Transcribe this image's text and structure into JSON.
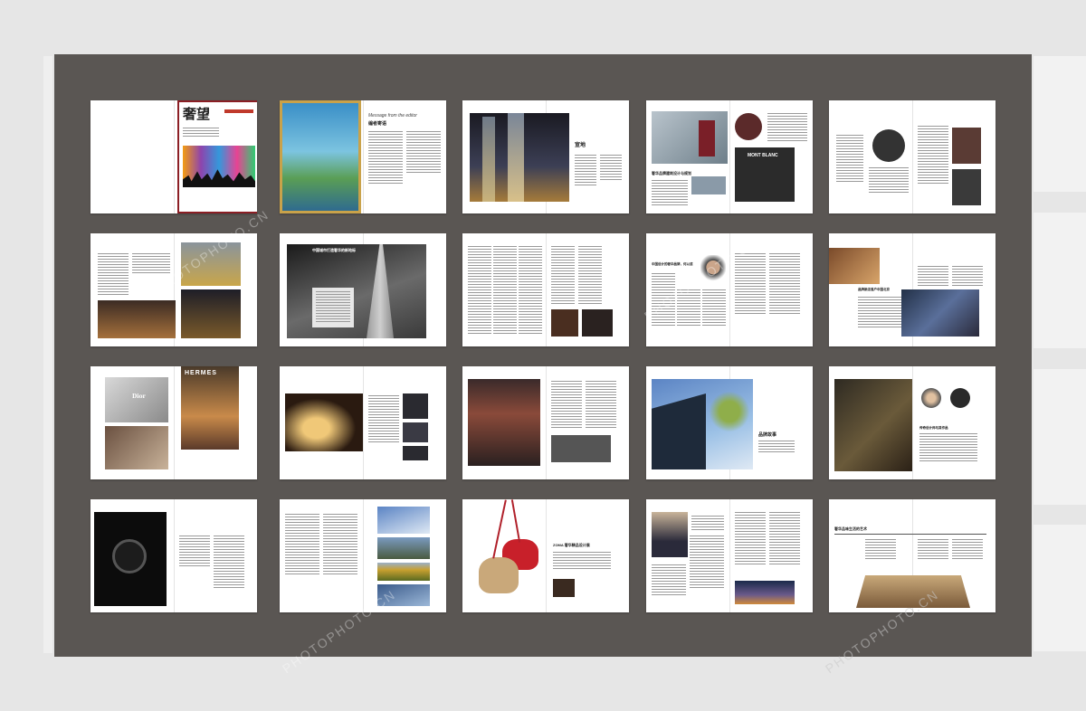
{
  "magazine": {
    "cover_title": "奢望",
    "cover_subtitle": "奢华品牌鉴赏与解读",
    "editorial_heading": "Message from the editor",
    "editorial_subheading": "编者寄语"
  },
  "spreads": [
    {
      "id": "cover",
      "heading": ""
    },
    {
      "id": "editorial",
      "heading": "编者寄语"
    },
    {
      "id": "night-towers",
      "heading": "宣地"
    },
    {
      "id": "mont-blanc",
      "heading": "奢华品牌建筑设计与规划"
    },
    {
      "id": "round-photo",
      "heading": ""
    },
    {
      "id": "street-photos",
      "heading": ""
    },
    {
      "id": "foggy-tower",
      "heading": "中国城市打造奢华的新地标"
    },
    {
      "id": "text-spread",
      "heading": ""
    },
    {
      "id": "portrait-text",
      "heading": "中国设计的奢华品牌，何以成"
    },
    {
      "id": "interview",
      "heading": "品牌新店落户中国北京"
    },
    {
      "id": "hermes",
      "heading": "HERMES"
    },
    {
      "id": "eggshell",
      "heading": ""
    },
    {
      "id": "luxury-window",
      "heading": ""
    },
    {
      "id": "brand-story",
      "heading": "品牌故事"
    },
    {
      "id": "designer",
      "heading": "传奇设计师与其作品"
    },
    {
      "id": "watch",
      "heading": ""
    },
    {
      "id": "building-fields",
      "heading": ""
    },
    {
      "id": "handbags",
      "heading": "ZOMA 奢华精品设计展"
    },
    {
      "id": "portrait-city",
      "heading": ""
    },
    {
      "id": "table-setting",
      "heading": "奢华品味生活的艺术"
    }
  ],
  "dior_label": "Dior",
  "mont_blanc_label": "MONT BLANC",
  "hermes_label": "HERMES",
  "watermark_text": "PHOTOPHOTO.CN"
}
